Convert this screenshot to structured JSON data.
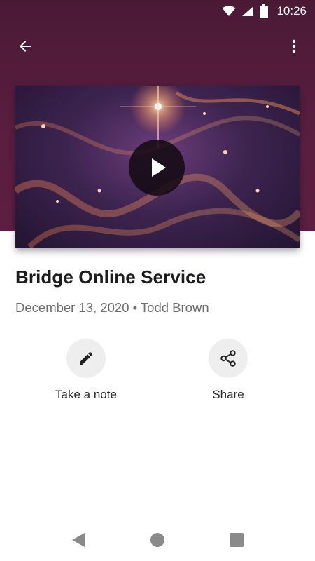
{
  "status_bar": {
    "time": "10:26",
    "icons": [
      "wifi-icon",
      "signal-icon",
      "battery-icon"
    ]
  },
  "app_bar": {
    "back_icon": "arrow-left-icon",
    "menu_icon": "more-vert-icon"
  },
  "video": {
    "play_icon": "play-icon"
  },
  "content": {
    "title": "Bridge Online Service",
    "subtitle": "December 13, 2020 • Todd Brown"
  },
  "actions": [
    {
      "label": "Take a note",
      "icon": "pencil-icon"
    },
    {
      "label": "Share",
      "icon": "share-icon"
    }
  ],
  "nav_bar": {
    "icons": [
      "nav-back-icon",
      "nav-home-icon",
      "nav-recents-icon"
    ]
  },
  "colors": {
    "header": "#4f1b39",
    "text_primary": "#1c1c1c",
    "text_secondary": "#6e6e6e",
    "action_bg": "#eeeeee"
  }
}
